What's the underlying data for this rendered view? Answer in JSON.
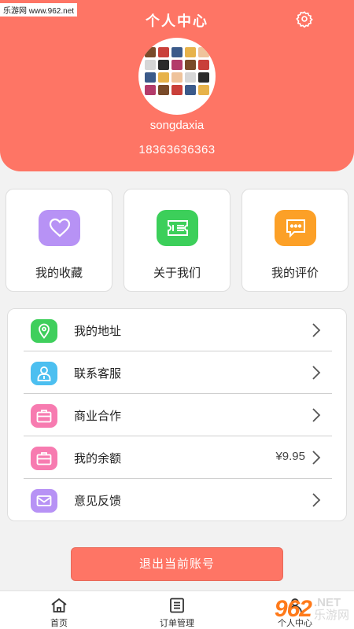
{
  "watermark": "乐游网 www.962.net",
  "header": {
    "title": "个人中心",
    "settings_icon": "gear-icon",
    "background_color": "#fe7565",
    "username": "songdaxia",
    "phone": "18363636363"
  },
  "cards": [
    {
      "label": "我的收藏",
      "icon": "heart-icon",
      "color": "#b792f5"
    },
    {
      "label": "关于我们",
      "icon": "ticket-icon",
      "color": "#3ccf5a"
    },
    {
      "label": "我的评价",
      "icon": "message-icon",
      "color": "#fca027"
    }
  ],
  "menu": [
    {
      "label": "我的地址",
      "icon": "location-pin-icon",
      "color": "#3fcf5c",
      "extra": ""
    },
    {
      "label": "联系客服",
      "icon": "person-icon",
      "color": "#4cbff0",
      "extra": ""
    },
    {
      "label": "商业合作",
      "icon": "briefcase-icon",
      "color": "#f77bb0",
      "extra": ""
    },
    {
      "label": "我的余额",
      "icon": "wallet-icon",
      "color": "#f77bb0",
      "extra": "¥9.95"
    },
    {
      "label": "意见反馈",
      "icon": "mail-icon",
      "color": "#b792f5",
      "extra": ""
    }
  ],
  "logout_label": "退出当前账号",
  "tabbar": {
    "tabs": [
      {
        "label": "首页",
        "icon": "home-icon"
      },
      {
        "label": "订单管理",
        "icon": "order-list-icon"
      },
      {
        "label": "个人中心",
        "icon": "user-icon"
      }
    ]
  },
  "brand": {
    "number": "962",
    "domain": ".NET",
    "site": "乐游网"
  }
}
